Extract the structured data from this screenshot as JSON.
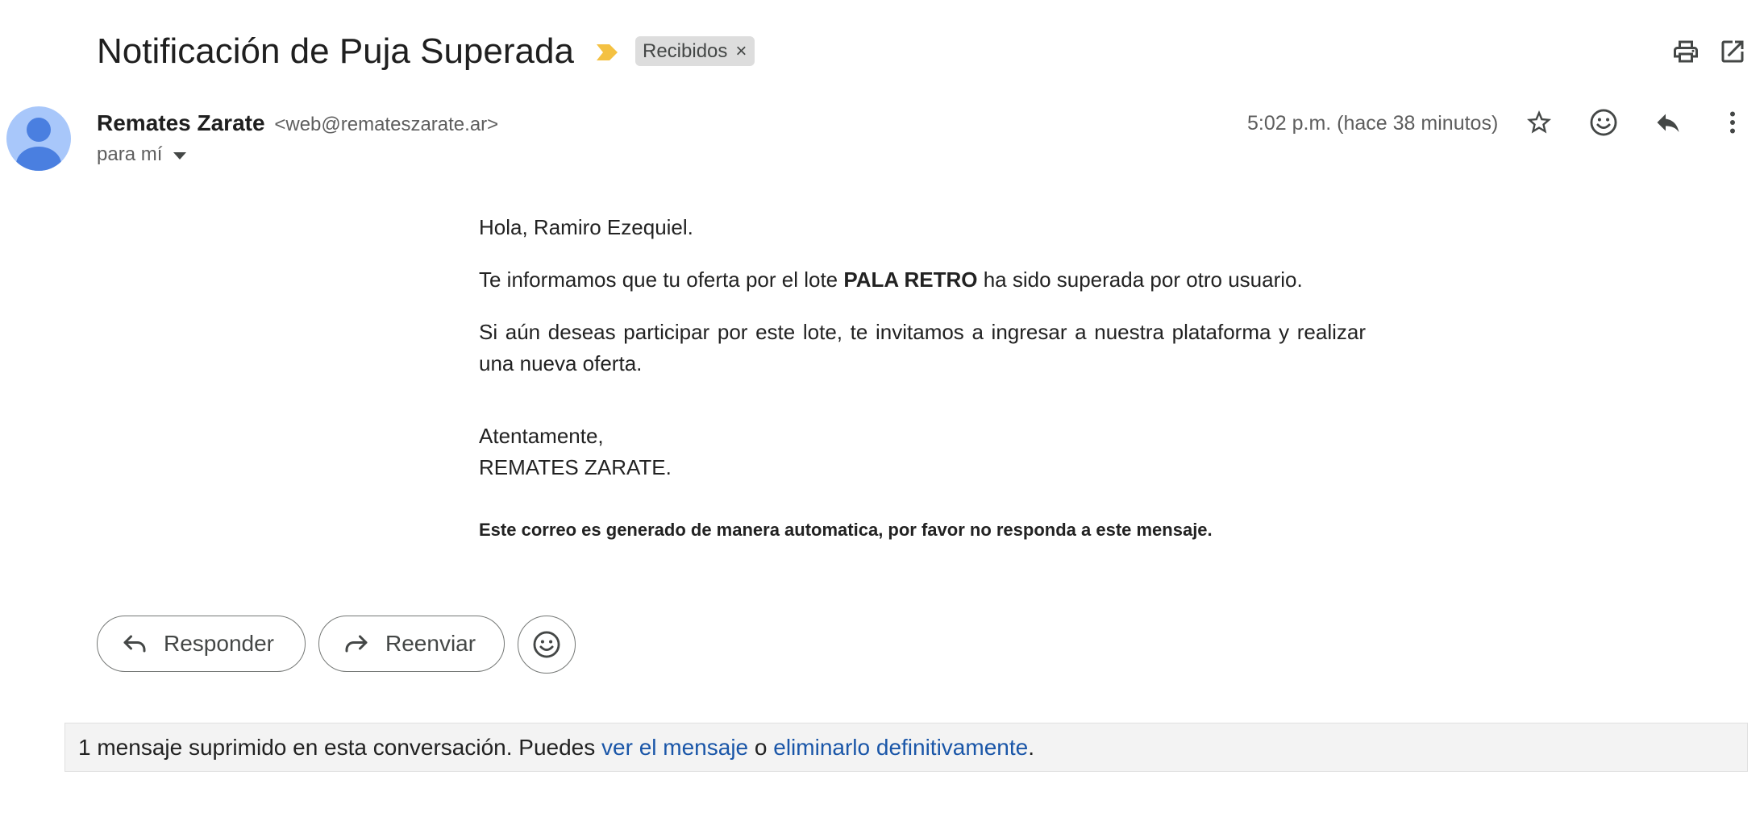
{
  "email": {
    "subject": "Notificación de Puja Superada",
    "label": "Recibidos",
    "label_remove": "×",
    "sender_name": "Remates Zarate",
    "sender_email": "<web@remateszarate.ar>",
    "recipient": "para mí",
    "time": "5:02 p.m. (hace 38 minutos)"
  },
  "body": {
    "greeting": "Hola, Ramiro Ezequiel.",
    "line1_before": "Te informamos que tu oferta por el lote ",
    "lot_name": "PALA RETRO",
    "line1_after": " ha sido superada por otro usuario.",
    "line2": "Si aún deseas participar por este lote, te invitamos a ingresar a nuestra plataforma y realizar una nueva oferta.",
    "closing": "Atentamente,",
    "signature": "REMATES ZARATE.",
    "footnote": "Este correo es generado de manera automatica, por favor no responda a este mensaje."
  },
  "actions": {
    "reply_label": "Responder",
    "forward_label": "Reenviar"
  },
  "suppressed": {
    "text_before": "1 mensaje suprimido en esta conversación. Puedes ",
    "view_link": "ver el mensaje",
    "middle": " o ",
    "delete_link": "eliminarlo definitivamente",
    "end": "."
  },
  "icons": {
    "header": [
      "print-icon",
      "open-in-new-window-icon"
    ],
    "message": [
      "star-icon",
      "emoji-reaction-icon",
      "reply-icon",
      "more-options-icon"
    ],
    "importance_color": "#f4c142",
    "avatar_color": "#a8c7fa",
    "avatar_figure_color": "#4a7fe0",
    "link_color": "#1a56a8"
  }
}
